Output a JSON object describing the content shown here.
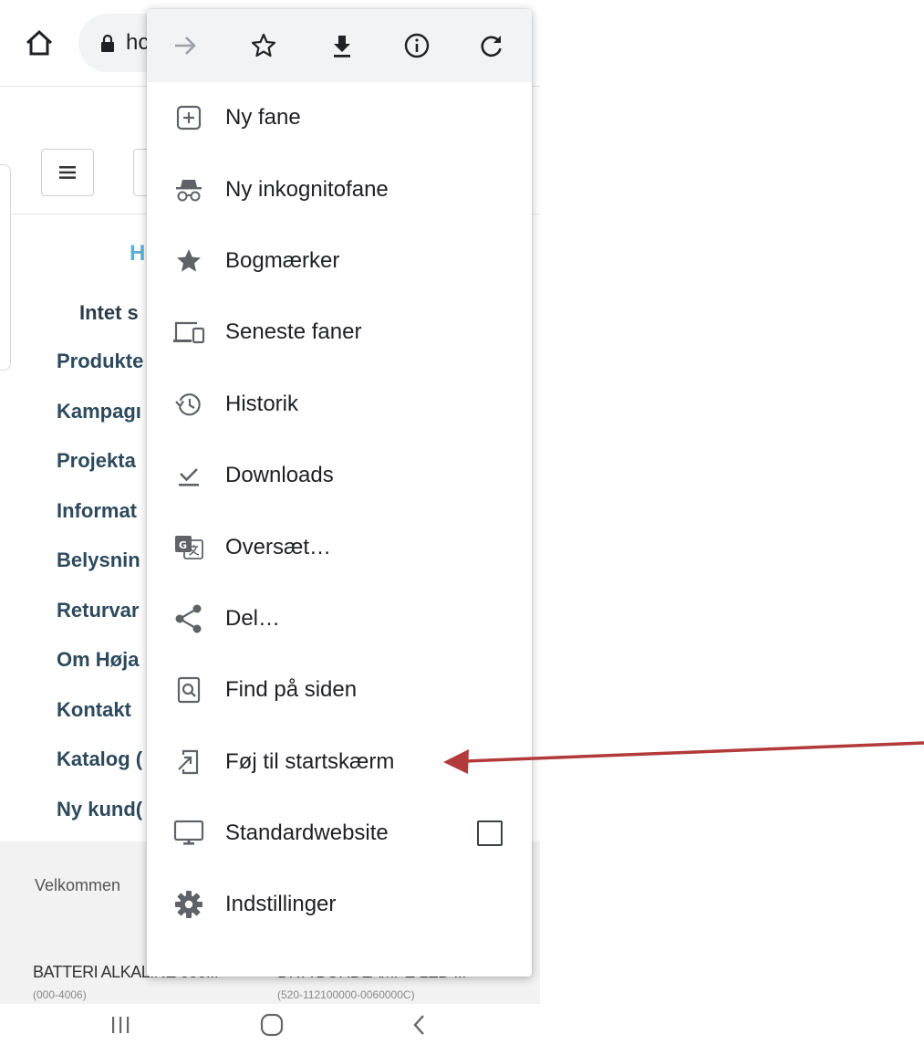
{
  "toolbar": {
    "url_fragment": "hc"
  },
  "page": {
    "hello_fragment": "H",
    "cart_fragment": "Intet s",
    "nav_links": [
      "Produkte",
      "Kampagı",
      "Projekta",
      "Informat",
      "Belysnin",
      "Returvar",
      "Om Høja",
      "Kontakt",
      "Katalog (",
      "Ny kund("
    ],
    "welcome_fragment": "Velkommen",
    "product_1_name": "BATTERI ALKALINE 000...",
    "product_1_sub": "(000-4006)",
    "product_2_name": "DIVA BORDLAMPE LED ...",
    "product_2_sub": "(520-112100000-0060000C)"
  },
  "menu": {
    "iconbar": [
      "forward-icon",
      "bookmark-star-icon",
      "download-icon",
      "info-icon",
      "refresh-icon"
    ],
    "items": [
      {
        "label": "Ny fane",
        "icon": "new-tab-icon"
      },
      {
        "label": "Ny inkognitofane",
        "icon": "incognito-icon"
      },
      {
        "label": "Bogmærker",
        "icon": "star-icon"
      },
      {
        "label": "Seneste faner",
        "icon": "devices-icon"
      },
      {
        "label": "Historik",
        "icon": "history-icon"
      },
      {
        "label": "Downloads",
        "icon": "downloads-icon"
      },
      {
        "label": "Oversæt…",
        "icon": "translate-icon"
      },
      {
        "label": "Del…",
        "icon": "share-icon"
      },
      {
        "label": "Find på siden",
        "icon": "find-in-page-icon"
      },
      {
        "label": "Føj til startskærm",
        "icon": "add-to-home-icon"
      },
      {
        "label": "Standardwebsite",
        "icon": "desktop-icon",
        "checkbox": false
      },
      {
        "label": "Indstillinger",
        "icon": "settings-gear-icon"
      }
    ]
  },
  "colors": {
    "menu_bar_bg": "#f1f3f4",
    "menu_text": "#202124",
    "icon_gray": "#5f6368",
    "annotation_arrow": "#b23a3a",
    "site_link": "#2d4a5c",
    "site_accent": "#5ab0d8"
  }
}
